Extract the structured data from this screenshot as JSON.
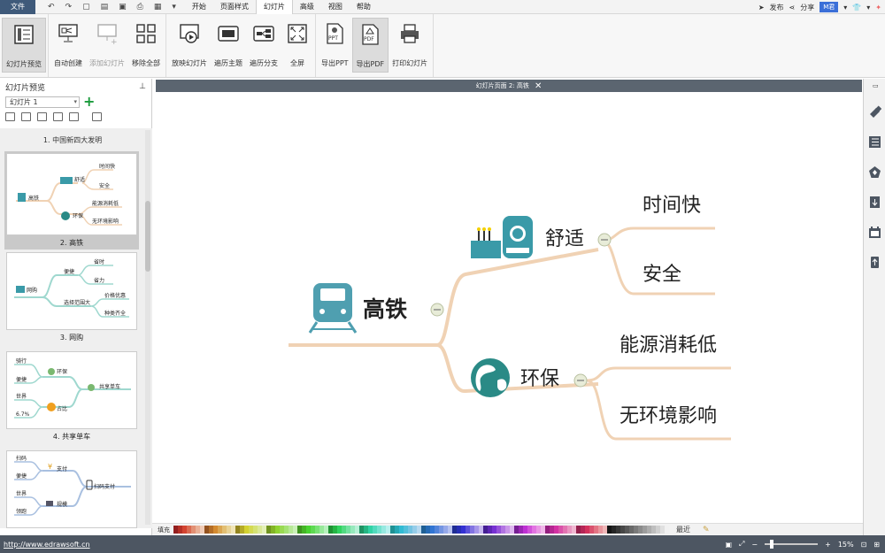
{
  "menu": {
    "file": "文件",
    "items": [
      "开始",
      "页面样式",
      "幻灯片",
      "高级",
      "视图",
      "帮助"
    ],
    "active": "幻灯片",
    "right": {
      "publish": "发布",
      "share": "分享",
      "user": "M君"
    }
  },
  "ribbon": {
    "buttons": [
      {
        "label": "幻灯片预览",
        "icon": "slide-preview-icon",
        "active": true
      },
      {
        "label": "自动创建",
        "icon": "auto-create-icon"
      },
      {
        "label": "添加幻灯片",
        "icon": "add-slide-icon",
        "disabled": true
      },
      {
        "label": "移除全部",
        "icon": "remove-all-icon"
      },
      {
        "label": "放映幻灯片",
        "icon": "play-slides-icon"
      },
      {
        "label": "遍历主题",
        "icon": "traverse-topic-icon"
      },
      {
        "label": "遍历分支",
        "icon": "traverse-branch-icon"
      },
      {
        "label": "全屏",
        "icon": "fullscreen-icon"
      },
      {
        "label": "导出PPT",
        "icon": "export-ppt-icon",
        "badge": "PPT"
      },
      {
        "label": "导出PDF",
        "icon": "export-pdf-icon",
        "badge": "PDF",
        "active": true
      },
      {
        "label": "打印幻灯片",
        "icon": "print-slides-icon"
      }
    ]
  },
  "left_panel": {
    "title": "幻灯片预览",
    "select_value": "幻灯片 1",
    "slides": [
      {
        "caption": "1. 中国新四大发明"
      },
      {
        "caption": "2. 高铁",
        "selected": true,
        "thumb": {
          "center": "高铁",
          "branches": [
            "舒适",
            "环保"
          ],
          "leaves": [
            "时间快",
            "安全",
            "能源消耗低",
            "无环境影响"
          ]
        }
      },
      {
        "caption": "3. 网购",
        "thumb": {
          "center": "网购",
          "branches": [
            "便捷",
            "选择范围大"
          ],
          "leaves": [
            "省时",
            "省力",
            "价格优惠",
            "种类齐全"
          ]
        }
      },
      {
        "caption": "4. 共享单车",
        "thumb": {
          "center": "共享单车",
          "branches": [
            "环保",
            "占比"
          ],
          "leaves": [
            "骑行",
            "便捷",
            "世界",
            "6.7%"
          ]
        }
      },
      {
        "caption": "",
        "thumb": {
          "center": "扫码支付",
          "branches": [
            "支付",
            "规模"
          ],
          "leaves": [
            "扫码",
            "便捷",
            "世界",
            "领跑"
          ]
        }
      }
    ]
  },
  "canvas": {
    "tab_title": "幻灯片页面 2: 高铁",
    "mindmap": {
      "center": "高铁",
      "branches": [
        {
          "label": "舒适",
          "icon": "train-front-icon",
          "leaves": [
            "时间快",
            "安全"
          ]
        },
        {
          "label": "环保",
          "icon": "globe-icon",
          "leaves": [
            "能源消耗低",
            "无环境影响"
          ]
        }
      ]
    }
  },
  "palette": {
    "label": "填充",
    "recent": "最近"
  },
  "status": {
    "url": "http://www.edrawsoft.cn",
    "zoom": "15%"
  },
  "colors": {
    "branch_line": "#f0d2b4",
    "teal_icon": "#3a9aa8",
    "green_add": "#1a9b3c"
  }
}
